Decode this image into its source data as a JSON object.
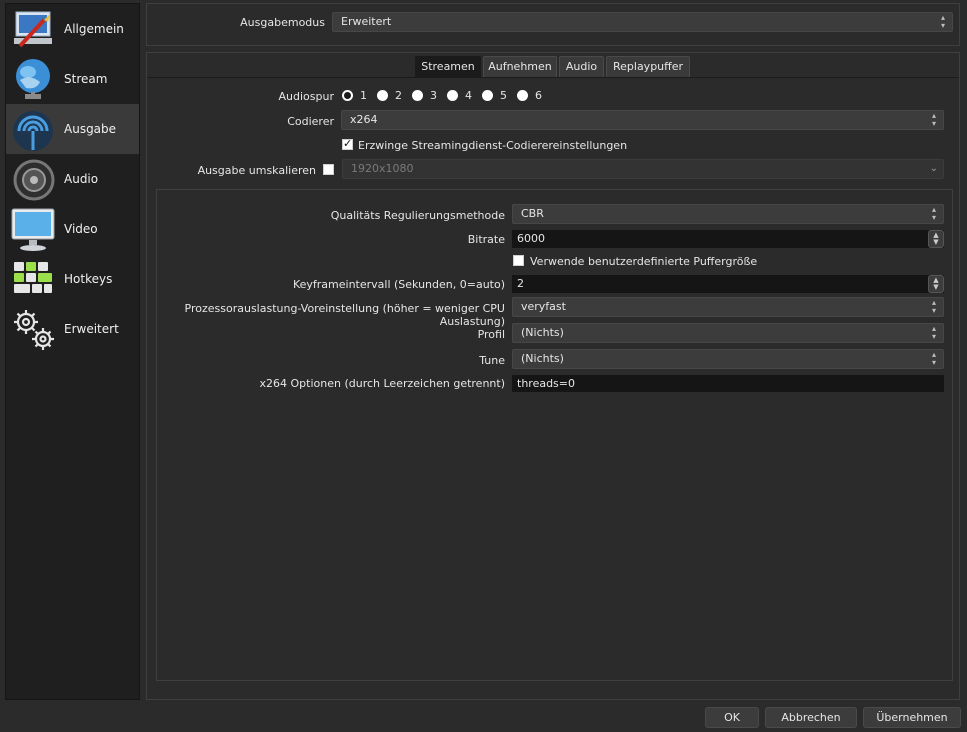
{
  "sidebar": {
    "items": [
      {
        "label": "Allgemein",
        "icon": "general-settings-icon"
      },
      {
        "label": "Stream",
        "icon": "globe-icon"
      },
      {
        "label": "Ausgabe",
        "icon": "broadcast-icon"
      },
      {
        "label": "Audio",
        "icon": "speaker-icon"
      },
      {
        "label": "Video",
        "icon": "monitor-icon"
      },
      {
        "label": "Hotkeys",
        "icon": "keyboard-icon"
      },
      {
        "label": "Erweitert",
        "icon": "gears-icon"
      }
    ],
    "active_index": 2
  },
  "output_mode": {
    "label": "Ausgabemodus",
    "value": "Erweitert"
  },
  "tabs": [
    {
      "label": "Streamen",
      "active": true
    },
    {
      "label": "Aufnehmen",
      "active": false
    },
    {
      "label": "Audio",
      "active": false
    },
    {
      "label": "Replaypuffer",
      "active": false
    }
  ],
  "audio_track": {
    "label": "Audiospur",
    "options": [
      "1",
      "2",
      "3",
      "4",
      "5",
      "6"
    ],
    "selected": "1"
  },
  "encoder": {
    "label": "Codierer",
    "value": "x264"
  },
  "enforce_settings": {
    "label": "Erzwinge Streamingdienst-Codierereinstellungen",
    "checked": true
  },
  "rescale": {
    "label": "Ausgabe umskalieren",
    "checked": false,
    "value": "1920x1080"
  },
  "encoder_settings": {
    "rate_control": {
      "label": "Qualitäts Regulierungsmethode",
      "value": "CBR"
    },
    "bitrate": {
      "label": "Bitrate",
      "value": "6000"
    },
    "custom_buffer": {
      "label": "Verwende benutzerdefinierte Puffergröße",
      "checked": false
    },
    "keyframe": {
      "label": "Keyframeintervall (Sekunden, 0=auto)",
      "value": "2"
    },
    "preset": {
      "label": "Prozessorauslastung-Voreinstellung (höher = weniger CPU Auslastung)",
      "value": "veryfast"
    },
    "profile": {
      "label": "Profil",
      "value": "(Nichts)"
    },
    "tune": {
      "label": "Tune",
      "value": "(Nichts)"
    },
    "x264_options": {
      "label": "x264 Optionen (durch Leerzeichen getrennt)",
      "value": "threads=0"
    }
  },
  "buttons": {
    "ok": "OK",
    "cancel": "Abbrechen",
    "apply": "Übernehmen"
  }
}
